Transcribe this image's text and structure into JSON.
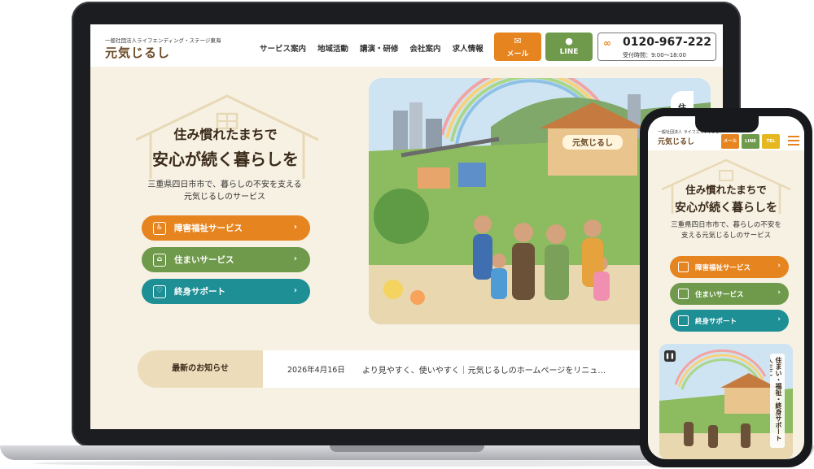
{
  "header": {
    "org_sub": "一般社団法人ライフエンディング・ステージ東海",
    "logo": "元気じるし",
    "nav": [
      "サービス案内",
      "地域活動",
      "講演・研修",
      "会社案内",
      "求人情報"
    ],
    "mail_label": "メール",
    "line_label": "LINE",
    "tel_number": "0120-967-222",
    "tel_hours": "受付時間：9:00〜18:00"
  },
  "hero": {
    "title_line1": "住み慣れたまちで",
    "title_line2": "安心が続く暮らしを",
    "desc_line1": "三重県四日市市で、暮らしの不安を支える",
    "desc_line2": "元気じるしのサービス",
    "services": [
      {
        "label": "障害福祉サービス",
        "color": "#e6841f",
        "icon": "wheelchair-icon"
      },
      {
        "label": "住まいサービス",
        "color": "#6f9a4b",
        "icon": "house-icon"
      },
      {
        "label": "終身サポート",
        "color": "#1f8f96",
        "icon": "heart-icon"
      }
    ],
    "side_label": "住"
  },
  "news": {
    "label": "最新のお知らせ",
    "date": "2026年4月16日",
    "text": "より見やすく、使いやすく｜元気じるしのホームページをリニュ…"
  },
  "phone": {
    "org_sub": "一般社団法人 ライフエンディング",
    "logo": "元気じるし",
    "mail_label": "メール",
    "line_label": "LINE",
    "tel_label": "TEL",
    "title_line1": "住み慣れたまちで",
    "title_line2": "安心が続く暮らしを",
    "desc_line1": "三重県四日市市で、暮らしの不安を",
    "desc_line2": "支える元気じるしのサービス",
    "services": [
      "障害福祉サービス",
      "住まいサービス",
      "終身サポート"
    ],
    "vertical_label": "住まい・福祉・終身サポート 人生に"
  }
}
